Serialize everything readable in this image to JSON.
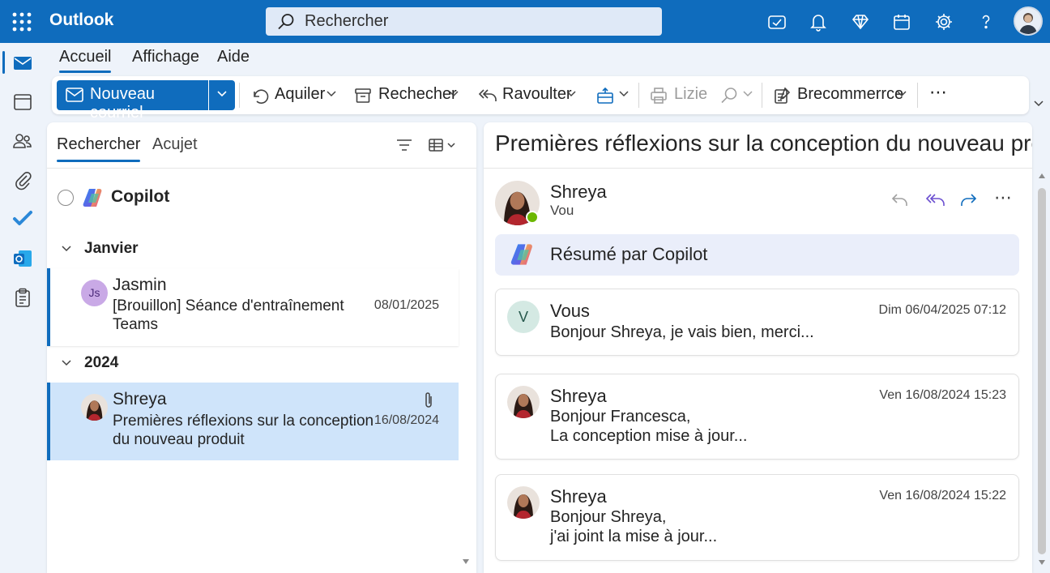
{
  "app": {
    "name": "Outlook",
    "accent": "#0f6cbd"
  },
  "search": {
    "placeholder": "Rechercher"
  },
  "topbar_icons": [
    "meet-now-icon",
    "bell-icon",
    "premium-diamond-icon",
    "my-day-icon",
    "settings-gear-icon",
    "help-icon",
    "account-avatar"
  ],
  "rail_icons": [
    "mail-icon",
    "calendar-icon",
    "people-icon",
    "attachment-icon",
    "todo-check-icon",
    "outlook-app-icon",
    "clipboard-icon"
  ],
  "ribbon": {
    "tabs": [
      "Accueil",
      "Affichage",
      "Aide"
    ],
    "active_tab": "Accueil"
  },
  "toolbar": {
    "new_mail": "Nouveau courriel",
    "btn_aquiler": "Aquiler",
    "btn_rechecher": "Rechecher",
    "btn_ravoulter": "Ravoulter",
    "btn_lizie": "Lizie",
    "btn_brecommerrce": "Brecommerrce",
    "more": "⋯"
  },
  "list": {
    "tabs": [
      "Rechercher",
      "Acujet"
    ],
    "copilot_label": "Copilot",
    "groups": [
      {
        "label": "Janvier",
        "items": [
          {
            "sender": "Jasmin",
            "initials": "Js",
            "subject_line1": "[Brouillon] Séance d'entraînement",
            "subject_line2": "Teams",
            "date": "08/01/2025"
          }
        ]
      },
      {
        "label": "2024",
        "items": [
          {
            "sender": "Shreya",
            "subject_line1": "Premières réflexions sur la conception",
            "subject_line2": "du nouveau produit",
            "date": "16/08/2024",
            "has_attachment": true,
            "selected": true
          }
        ]
      }
    ]
  },
  "reading": {
    "title": "Premières réflexions sur la conception du nouveau produit",
    "header": {
      "sender": "Shreya",
      "to": "Vou"
    },
    "summary_label": "Résumé par Copilot",
    "messages": [
      {
        "sender": "Vous",
        "initial": "V",
        "date": "Dim 06/04/2025 07:12",
        "lines": [
          "Bonjour Shreya, je vais bien, merci..."
        ]
      },
      {
        "sender": "Shreya",
        "date": "Ven 16/08/2024 15:23",
        "lines": [
          "Bonjour Francesca,",
          "La conception mise à jour..."
        ]
      },
      {
        "sender": "Shreya",
        "date": "Ven 16/08/2024 15:22",
        "lines": [
          "Bonjour Shreya,",
          "j'ai joint la mise à jour..."
        ]
      }
    ]
  }
}
